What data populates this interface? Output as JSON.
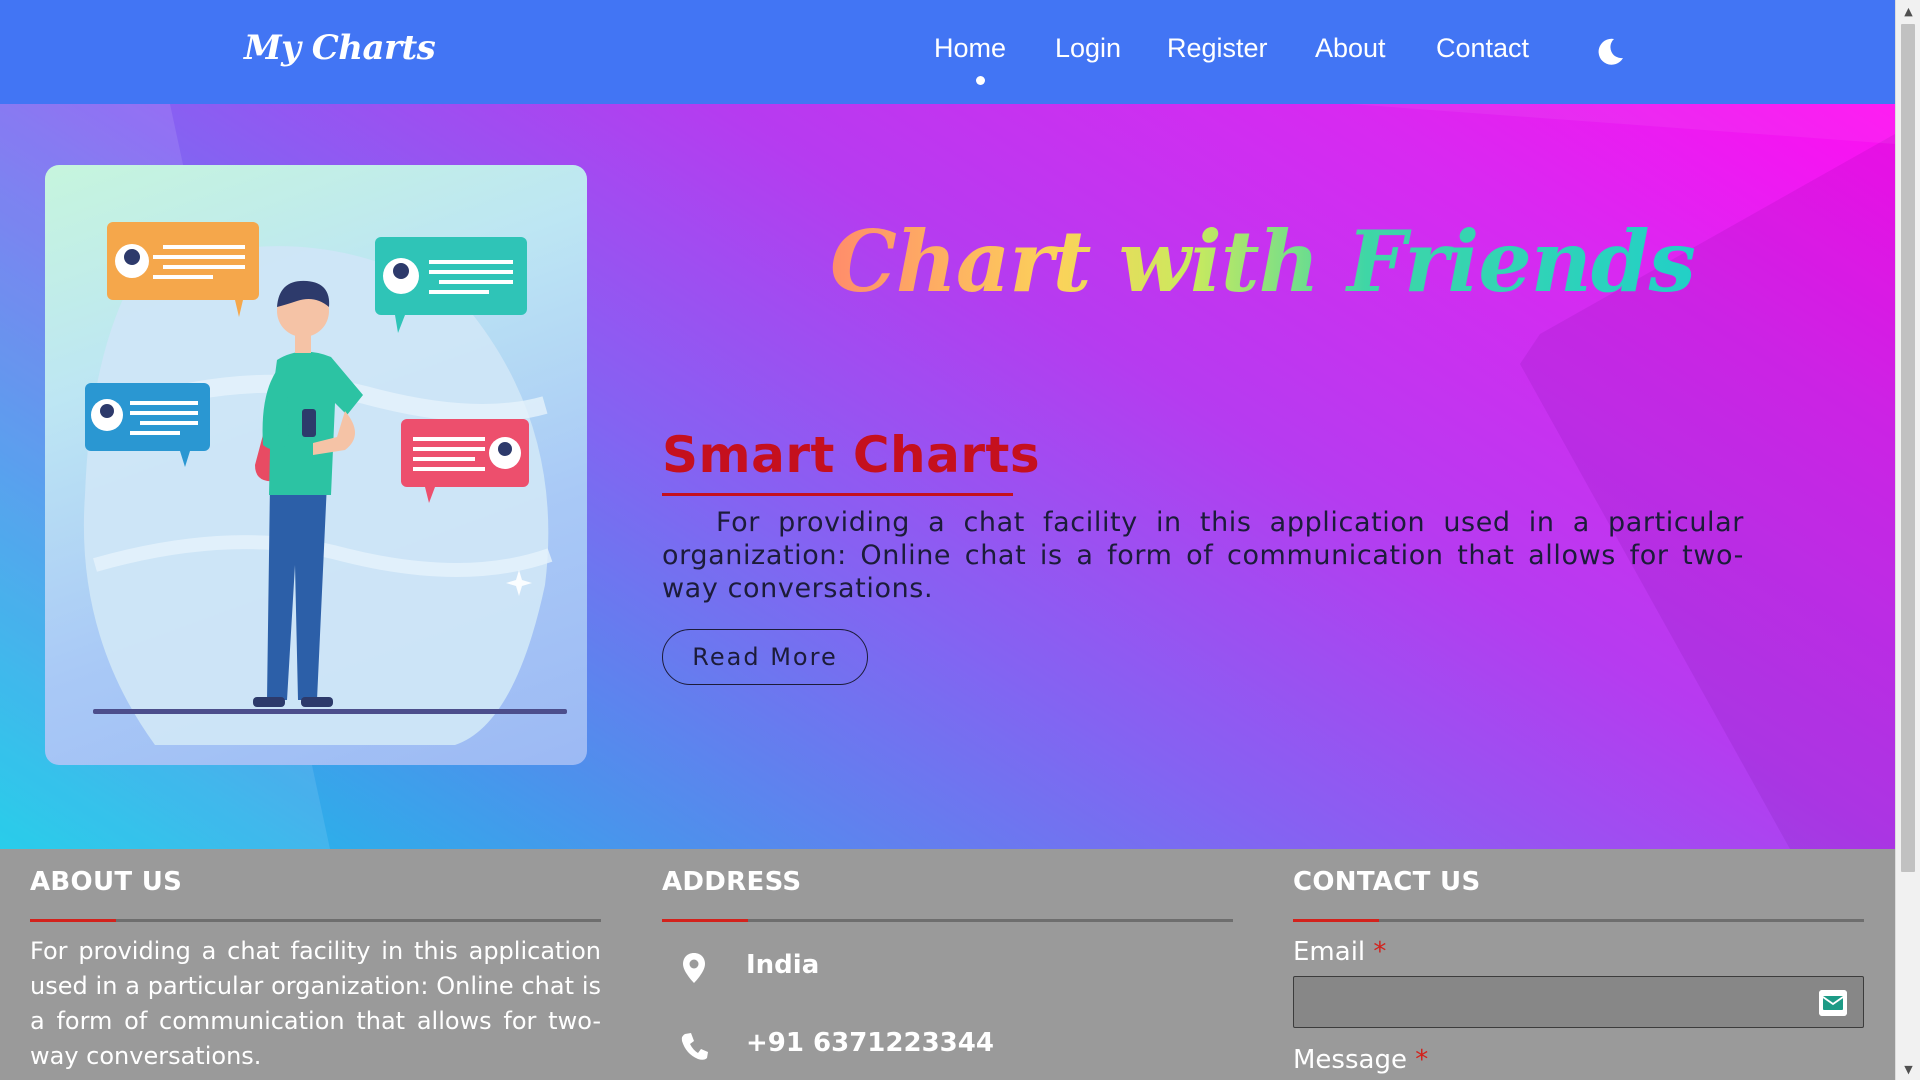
{
  "navbar": {
    "brand": "My Charts",
    "items": [
      {
        "label": "Home",
        "active": true
      },
      {
        "label": "Login"
      },
      {
        "label": "Register"
      },
      {
        "label": "About"
      },
      {
        "label": "Contact"
      }
    ],
    "theme_toggle_icon": "moon-icon"
  },
  "hero": {
    "title": "Chart with Friends",
    "subtitle": "Smart Charts",
    "description": "For providing a chat facility in this application used in a particular organization: Online chat is a form of communication that allows for two-way conversations.",
    "read_more_label": "Read More",
    "illustration": "person-chatting-illustration",
    "colors": {
      "gradient_start": "#11c8e8",
      "gradient_end": "#ff0ef2",
      "subtitle": "#c5101e"
    }
  },
  "footer": {
    "about": {
      "heading": "ABOUT US",
      "text": "For providing a chat facility in this application used in a particular organization: Online chat is a form of communication that allows for two-way conversations."
    },
    "address": {
      "heading": "ADDRESS",
      "location": "India",
      "location_icon": "map-pin-icon",
      "phone": "+91 6371223344",
      "phone_icon": "phone-icon"
    },
    "contact": {
      "heading": "CONTACT US",
      "email_label": "Email",
      "message_label": "Message",
      "required_mark": "*",
      "email_value": "",
      "email_icon": "mail-icon"
    },
    "colors": {
      "background": "#9a9a9a",
      "accent": "#d3221c"
    }
  },
  "navbar_colors": {
    "background": "#4275f4"
  }
}
